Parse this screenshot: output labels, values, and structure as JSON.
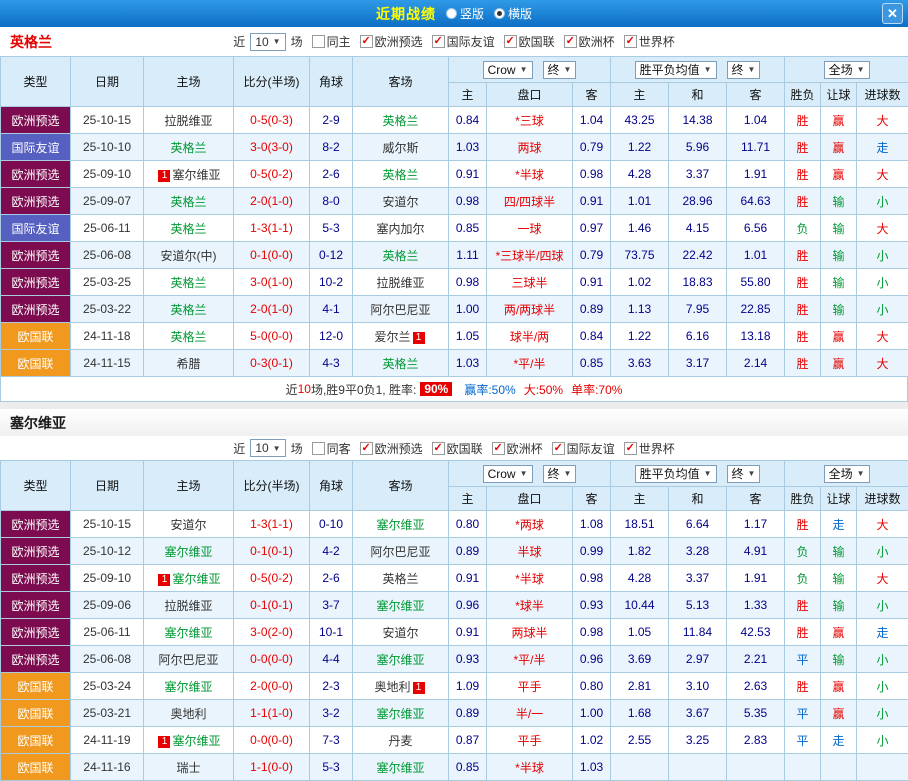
{
  "icons": {
    "arrow": "▼",
    "check": "✓",
    "close": "✕"
  },
  "topbar": {
    "title": "近期战绩",
    "vertical": {
      "label": "竖版",
      "state": ""
    },
    "horizontal": {
      "label": "横版",
      "state": "sel"
    }
  },
  "sections": [
    {
      "team": "英格兰",
      "team_class": "red",
      "head_class": "inline",
      "sec_class": "",
      "filter": {
        "near": "近",
        "count": "10",
        "games": "场",
        "checkboxes": [
          {
            "label": "同主",
            "state": ""
          },
          {
            "label": "欧洲预选",
            "state": "checked"
          },
          {
            "label": "国际友谊",
            "state": "checked"
          },
          {
            "label": "欧国联",
            "state": "checked"
          },
          {
            "label": "欧洲杯",
            "state": "checked"
          },
          {
            "label": "世界杯",
            "state": "checked"
          }
        ]
      },
      "headers": {
        "type": "类型",
        "date": "日期",
        "home": "主场",
        "score": "比分(半场)",
        "corner": "角球",
        "away": "客场",
        "odds_source": "Crow",
        "final1": "终",
        "avg_label": "胜平负均值",
        "final2": "终",
        "scope": "全场",
        "h_home": "主",
        "h_handicap": "盘口",
        "h_away": "客",
        "a_home": "主",
        "a_draw": "和",
        "a_away": "客",
        "r_wdl": "胜负",
        "r_let": "让球",
        "r_goals": "进球数"
      },
      "rows": [
        {
          "type": "欧洲预选",
          "type_class": "t-pre",
          "date": "25-10-15",
          "home": "拉脱维亚",
          "home_class": "",
          "home_badge": "",
          "score": "0-5(0-3)",
          "corner": "2-9",
          "away": "英格兰",
          "away_class": "focus",
          "away_badge": "",
          "odds_home": "0.84",
          "handicap": "*三球",
          "odds_away": "1.04",
          "avg_home": "43.25",
          "avg_draw": "14.38",
          "avg_away": "1.04",
          "res_wdl": "胜",
          "res_wdl_c": "red",
          "res_let": "赢",
          "res_let_c": "red",
          "res_goal": "大",
          "res_goal_c": "red"
        },
        {
          "type": "国际友谊",
          "type_class": "t-fri",
          "date": "25-10-10",
          "home": "英格兰",
          "home_class": "focus",
          "home_badge": "",
          "score": "3-0(3-0)",
          "corner": "8-2",
          "away": "威尔斯",
          "away_class": "",
          "away_badge": "",
          "odds_home": "1.03",
          "handicap": "两球",
          "odds_away": "0.79",
          "avg_home": "1.22",
          "avg_draw": "5.96",
          "avg_away": "11.71",
          "res_wdl": "胜",
          "res_wdl_c": "red",
          "res_let": "赢",
          "res_let_c": "red",
          "res_goal": "走",
          "res_goal_c": "blue"
        },
        {
          "type": "欧洲预选",
          "type_class": "t-pre",
          "date": "25-09-10",
          "home": "塞尔维亚",
          "home_class": "",
          "home_badge": "1",
          "score": "0-5(0-2)",
          "corner": "2-6",
          "away": "英格兰",
          "away_class": "focus",
          "away_badge": "",
          "odds_home": "0.91",
          "handicap": "*半球",
          "odds_away": "0.98",
          "avg_home": "4.28",
          "avg_draw": "3.37",
          "avg_away": "1.91",
          "res_wdl": "胜",
          "res_wdl_c": "red",
          "res_let": "赢",
          "res_let_c": "red",
          "res_goal": "大",
          "res_goal_c": "red"
        },
        {
          "type": "欧洲预选",
          "type_class": "t-pre",
          "date": "25-09-07",
          "home": "英格兰",
          "home_class": "focus",
          "home_badge": "",
          "score": "2-0(1-0)",
          "corner": "8-0",
          "away": "安道尔",
          "away_class": "",
          "away_badge": "",
          "odds_home": "0.98",
          "handicap": "四/四球半",
          "odds_away": "0.91",
          "avg_home": "1.01",
          "avg_draw": "28.96",
          "avg_away": "64.63",
          "res_wdl": "胜",
          "res_wdl_c": "red",
          "res_let": "输",
          "res_let_c": "green",
          "res_goal": "小",
          "res_goal_c": "green"
        },
        {
          "type": "国际友谊",
          "type_class": "t-fri",
          "date": "25-06-11",
          "home": "英格兰",
          "home_class": "focus",
          "home_badge": "",
          "score": "1-3(1-1)",
          "corner": "5-3",
          "away": "塞内加尔",
          "away_class": "",
          "away_badge": "",
          "odds_home": "0.85",
          "handicap": "一球",
          "odds_away": "0.97",
          "avg_home": "1.46",
          "avg_draw": "4.15",
          "avg_away": "6.56",
          "res_wdl": "负",
          "res_wdl_c": "green",
          "res_let": "输",
          "res_let_c": "green",
          "res_goal": "大",
          "res_goal_c": "red"
        },
        {
          "type": "欧洲预选",
          "type_class": "t-pre",
          "date": "25-06-08",
          "home": "安道尔(中)",
          "home_class": "",
          "home_badge": "",
          "score": "0-1(0-0)",
          "corner": "0-12",
          "away": "英格兰",
          "away_class": "focus",
          "away_badge": "",
          "odds_home": "1.11",
          "handicap": "*三球半/四球",
          "odds_away": "0.79",
          "avg_home": "73.75",
          "avg_draw": "22.42",
          "avg_away": "1.01",
          "res_wdl": "胜",
          "res_wdl_c": "red",
          "res_let": "输",
          "res_let_c": "green",
          "res_goal": "小",
          "res_goal_c": "green"
        },
        {
          "type": "欧洲预选",
          "type_class": "t-pre",
          "date": "25-03-25",
          "home": "英格兰",
          "home_class": "focus",
          "home_badge": "",
          "score": "3-0(1-0)",
          "corner": "10-2",
          "away": "拉脱维亚",
          "away_class": "",
          "away_badge": "",
          "odds_home": "0.98",
          "handicap": "三球半",
          "odds_away": "0.91",
          "avg_home": "1.02",
          "avg_draw": "18.83",
          "avg_away": "55.80",
          "res_wdl": "胜",
          "res_wdl_c": "red",
          "res_let": "输",
          "res_let_c": "green",
          "res_goal": "小",
          "res_goal_c": "green"
        },
        {
          "type": "欧洲预选",
          "type_class": "t-pre",
          "date": "25-03-22",
          "home": "英格兰",
          "home_class": "focus",
          "home_badge": "",
          "score": "2-0(1-0)",
          "corner": "4-1",
          "away": "阿尔巴尼亚",
          "away_class": "",
          "away_badge": "",
          "odds_home": "1.00",
          "handicap": "两/两球半",
          "odds_away": "0.89",
          "avg_home": "1.13",
          "avg_draw": "7.95",
          "avg_away": "22.85",
          "res_wdl": "胜",
          "res_wdl_c": "red",
          "res_let": "输",
          "res_let_c": "green",
          "res_goal": "小",
          "res_goal_c": "green"
        },
        {
          "type": "欧国联",
          "type_class": "t-nat",
          "date": "24-11-18",
          "home": "英格兰",
          "home_class": "focus",
          "home_badge": "",
          "score": "5-0(0-0)",
          "corner": "12-0",
          "away": "爱尔兰",
          "away_class": "",
          "away_badge": "1",
          "odds_home": "1.05",
          "handicap": "球半/两",
          "odds_away": "0.84",
          "avg_home": "1.22",
          "avg_draw": "6.16",
          "avg_away": "13.18",
          "res_wdl": "胜",
          "res_wdl_c": "red",
          "res_let": "赢",
          "res_let_c": "red",
          "res_goal": "大",
          "res_goal_c": "red"
        },
        {
          "type": "欧国联",
          "type_class": "t-nat",
          "date": "24-11-15",
          "home": "希腊",
          "home_class": "",
          "home_badge": "",
          "score": "0-3(0-1)",
          "corner": "4-3",
          "away": "英格兰",
          "away_class": "focus",
          "away_badge": "",
          "odds_home": "1.03",
          "handicap": "*平/半",
          "odds_away": "0.85",
          "avg_home": "3.63",
          "avg_draw": "3.17",
          "avg_away": "2.14",
          "res_wdl": "胜",
          "res_wdl_c": "red",
          "res_let": "赢",
          "res_let_c": "red",
          "res_goal": "大",
          "res_goal_c": "red"
        }
      ],
      "summary": {
        "visible": "show",
        "pre": "近",
        "count": "10",
        "mid": "场,胜9平0负1, 胜率:",
        "win_rate": "90%",
        "seg_win": "赢率:50%",
        "seg_big": "大:50%",
        "seg_single": "单率:70%"
      }
    },
    {
      "team": "塞尔维亚",
      "team_class": "dark",
      "head_class": "stacked",
      "sec_class": "sec-gap",
      "filter": {
        "near": "近",
        "count": "10",
        "games": "场",
        "checkboxes": [
          {
            "label": "同客",
            "state": ""
          },
          {
            "label": "欧洲预选",
            "state": "checked"
          },
          {
            "label": "欧国联",
            "state": "checked"
          },
          {
            "label": "欧洲杯",
            "state": "checked"
          },
          {
            "label": "国际友谊",
            "state": "checked"
          },
          {
            "label": "世界杯",
            "state": "checked"
          }
        ]
      },
      "headers": {
        "type": "类型",
        "date": "日期",
        "home": "主场",
        "score": "比分(半场)",
        "corner": "角球",
        "away": "客场",
        "odds_source": "Crow",
        "final1": "终",
        "avg_label": "胜平负均值",
        "final2": "终",
        "scope": "全场",
        "h_home": "主",
        "h_handicap": "盘口",
        "h_away": "客",
        "a_home": "主",
        "a_draw": "和",
        "a_away": "客",
        "r_wdl": "胜负",
        "r_let": "让球",
        "r_goals": "进球数"
      },
      "rows": [
        {
          "type": "欧洲预选",
          "type_class": "t-pre",
          "date": "25-10-15",
          "home": "安道尔",
          "home_class": "",
          "home_badge": "",
          "score": "1-3(1-1)",
          "corner": "0-10",
          "away": "塞尔维亚",
          "away_class": "focus",
          "away_badge": "",
          "odds_home": "0.80",
          "handicap": "*两球",
          "odds_away": "1.08",
          "avg_home": "18.51",
          "avg_draw": "6.64",
          "avg_away": "1.17",
          "res_wdl": "胜",
          "res_wdl_c": "red",
          "res_let": "走",
          "res_let_c": "blue",
          "res_goal": "大",
          "res_goal_c": "red"
        },
        {
          "type": "欧洲预选",
          "type_class": "t-pre",
          "date": "25-10-12",
          "home": "塞尔维亚",
          "home_class": "focus",
          "home_badge": "",
          "score": "0-1(0-1)",
          "corner": "4-2",
          "away": "阿尔巴尼亚",
          "away_class": "",
          "away_badge": "",
          "odds_home": "0.89",
          "handicap": "半球",
          "odds_away": "0.99",
          "avg_home": "1.82",
          "avg_draw": "3.28",
          "avg_away": "4.91",
          "res_wdl": "负",
          "res_wdl_c": "green",
          "res_let": "输",
          "res_let_c": "green",
          "res_goal": "小",
          "res_goal_c": "green"
        },
        {
          "type": "欧洲预选",
          "type_class": "t-pre",
          "date": "25-09-10",
          "home": "塞尔维亚",
          "home_class": "focus",
          "home_badge": "1",
          "score": "0-5(0-2)",
          "corner": "2-6",
          "away": "英格兰",
          "away_class": "",
          "away_badge": "",
          "odds_home": "0.91",
          "handicap": "*半球",
          "odds_away": "0.98",
          "avg_home": "4.28",
          "avg_draw": "3.37",
          "avg_away": "1.91",
          "res_wdl": "负",
          "res_wdl_c": "green",
          "res_let": "输",
          "res_let_c": "green",
          "res_goal": "大",
          "res_goal_c": "red"
        },
        {
          "type": "欧洲预选",
          "type_class": "t-pre",
          "date": "25-09-06",
          "home": "拉脱维亚",
          "home_class": "",
          "home_badge": "",
          "score": "0-1(0-1)",
          "corner": "3-7",
          "away": "塞尔维亚",
          "away_class": "focus",
          "away_badge": "",
          "odds_home": "0.96",
          "handicap": "*球半",
          "odds_away": "0.93",
          "avg_home": "10.44",
          "avg_draw": "5.13",
          "avg_away": "1.33",
          "res_wdl": "胜",
          "res_wdl_c": "red",
          "res_let": "输",
          "res_let_c": "green",
          "res_goal": "小",
          "res_goal_c": "green"
        },
        {
          "type": "欧洲预选",
          "type_class": "t-pre",
          "date": "25-06-11",
          "home": "塞尔维亚",
          "home_class": "focus",
          "home_badge": "",
          "score": "3-0(2-0)",
          "corner": "10-1",
          "away": "安道尔",
          "away_class": "",
          "away_badge": "",
          "odds_home": "0.91",
          "handicap": "两球半",
          "odds_away": "0.98",
          "avg_home": "1.05",
          "avg_draw": "11.84",
          "avg_away": "42.53",
          "res_wdl": "胜",
          "res_wdl_c": "red",
          "res_let": "赢",
          "res_let_c": "red",
          "res_goal": "走",
          "res_goal_c": "blue"
        },
        {
          "type": "欧洲预选",
          "type_class": "t-pre",
          "date": "25-06-08",
          "home": "阿尔巴尼亚",
          "home_class": "",
          "home_badge": "",
          "score": "0-0(0-0)",
          "corner": "4-4",
          "away": "塞尔维亚",
          "away_class": "focus",
          "away_badge": "",
          "odds_home": "0.93",
          "handicap": "*平/半",
          "odds_away": "0.96",
          "avg_home": "3.69",
          "avg_draw": "2.97",
          "avg_away": "2.21",
          "res_wdl": "平",
          "res_wdl_c": "blue",
          "res_let": "输",
          "res_let_c": "green",
          "res_goal": "小",
          "res_goal_c": "green"
        },
        {
          "type": "欧国联",
          "type_class": "t-nat",
          "date": "25-03-24",
          "home": "塞尔维亚",
          "home_class": "focus",
          "home_badge": "",
          "score": "2-0(0-0)",
          "corner": "2-3",
          "away": "奥地利",
          "away_class": "",
          "away_badge": "1",
          "odds_home": "1.09",
          "handicap": "平手",
          "odds_away": "0.80",
          "avg_home": "2.81",
          "avg_draw": "3.10",
          "avg_away": "2.63",
          "res_wdl": "胜",
          "res_wdl_c": "red",
          "res_let": "赢",
          "res_let_c": "red",
          "res_goal": "小",
          "res_goal_c": "green"
        },
        {
          "type": "欧国联",
          "type_class": "t-nat",
          "date": "25-03-21",
          "home": "奥地利",
          "home_class": "",
          "home_badge": "",
          "score": "1-1(1-0)",
          "corner": "3-2",
          "away": "塞尔维亚",
          "away_class": "focus",
          "away_badge": "",
          "odds_home": "0.89",
          "handicap": "半/一",
          "odds_away": "1.00",
          "avg_home": "1.68",
          "avg_draw": "3.67",
          "avg_away": "5.35",
          "res_wdl": "平",
          "res_wdl_c": "blue",
          "res_let": "赢",
          "res_let_c": "red",
          "res_goal": "小",
          "res_goal_c": "green"
        },
        {
          "type": "欧国联",
          "type_class": "t-nat",
          "date": "24-11-19",
          "home": "塞尔维亚",
          "home_class": "focus",
          "home_badge": "1",
          "score": "0-0(0-0)",
          "corner": "7-3",
          "away": "丹麦",
          "away_class": "",
          "away_badge": "",
          "odds_home": "0.87",
          "handicap": "平手",
          "odds_away": "1.02",
          "avg_home": "2.55",
          "avg_draw": "3.25",
          "avg_away": "2.83",
          "res_wdl": "平",
          "res_wdl_c": "blue",
          "res_let": "走",
          "res_let_c": "blue",
          "res_goal": "小",
          "res_goal_c": "green"
        },
        {
          "type": "欧国联",
          "type_class": "t-nat",
          "date": "24-11-16",
          "home": "瑞士",
          "home_class": "",
          "home_badge": "",
          "score": "1-1(0-0)",
          "corner": "5-3",
          "away": "塞尔维亚",
          "away_class": "focus",
          "away_badge": "",
          "odds_home": "0.85",
          "handicap": "*半球",
          "odds_away": "1.03",
          "avg_home": "",
          "avg_draw": "",
          "avg_away": "",
          "res_wdl": "",
          "res_wdl_c": "",
          "res_let": "",
          "res_let_c": "",
          "res_goal": "",
          "res_goal_c": ""
        }
      ]
    }
  ]
}
